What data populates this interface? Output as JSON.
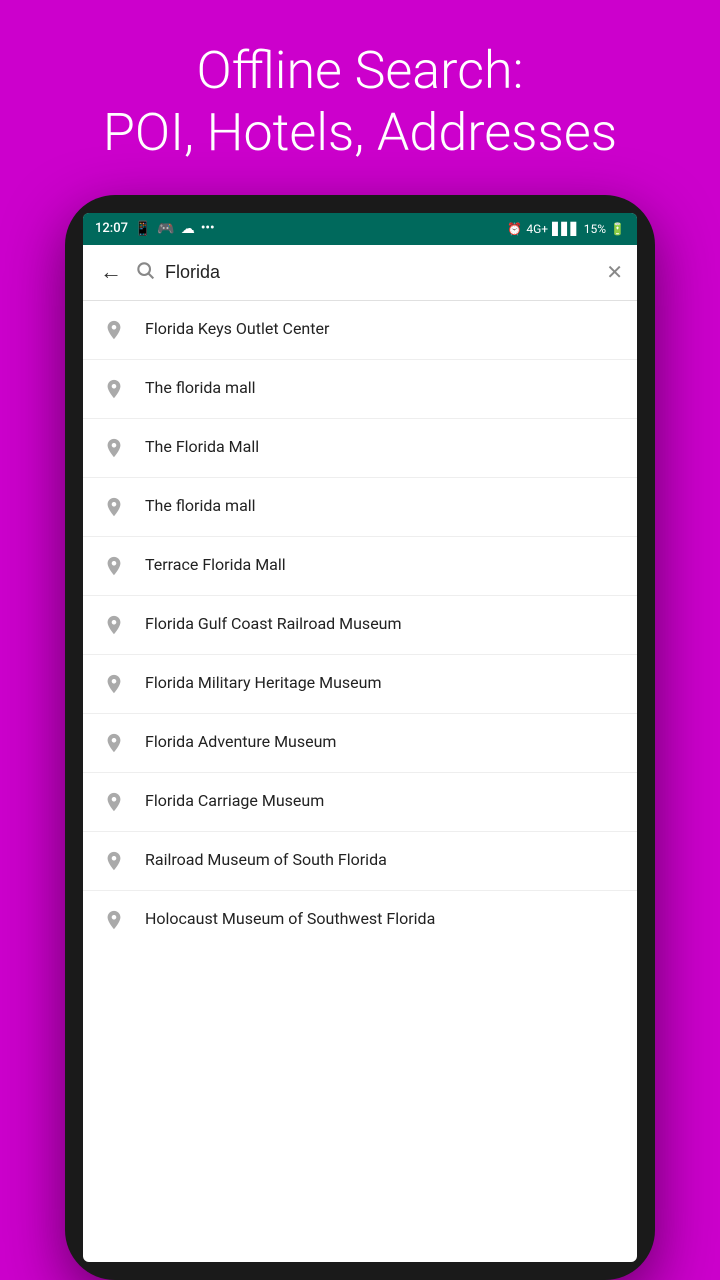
{
  "page": {
    "headline": "Offline Search:\nPOI, Hotels, Addresses",
    "background_color": "#cc00cc"
  },
  "status_bar": {
    "time": "12:07",
    "battery": "15%",
    "icons": "📱 4G+ signal"
  },
  "search": {
    "query": "Florida",
    "placeholder": "Search",
    "back_label": "←",
    "clear_label": "✕"
  },
  "results": [
    {
      "id": 1,
      "label": "Florida Keys Outlet Center"
    },
    {
      "id": 2,
      "label": "The florida mall"
    },
    {
      "id": 3,
      "label": "The Florida Mall"
    },
    {
      "id": 4,
      "label": "The florida mall"
    },
    {
      "id": 5,
      "label": "Terrace Florida Mall"
    },
    {
      "id": 6,
      "label": "Florida Gulf Coast Railroad Museum"
    },
    {
      "id": 7,
      "label": "Florida Military Heritage Museum"
    },
    {
      "id": 8,
      "label": "Florida Adventure Museum"
    },
    {
      "id": 9,
      "label": "Florida Carriage Museum"
    },
    {
      "id": 10,
      "label": "Railroad Museum of South Florida"
    },
    {
      "id": 11,
      "label": "Holocaust Museum of Southwest Florida"
    }
  ]
}
